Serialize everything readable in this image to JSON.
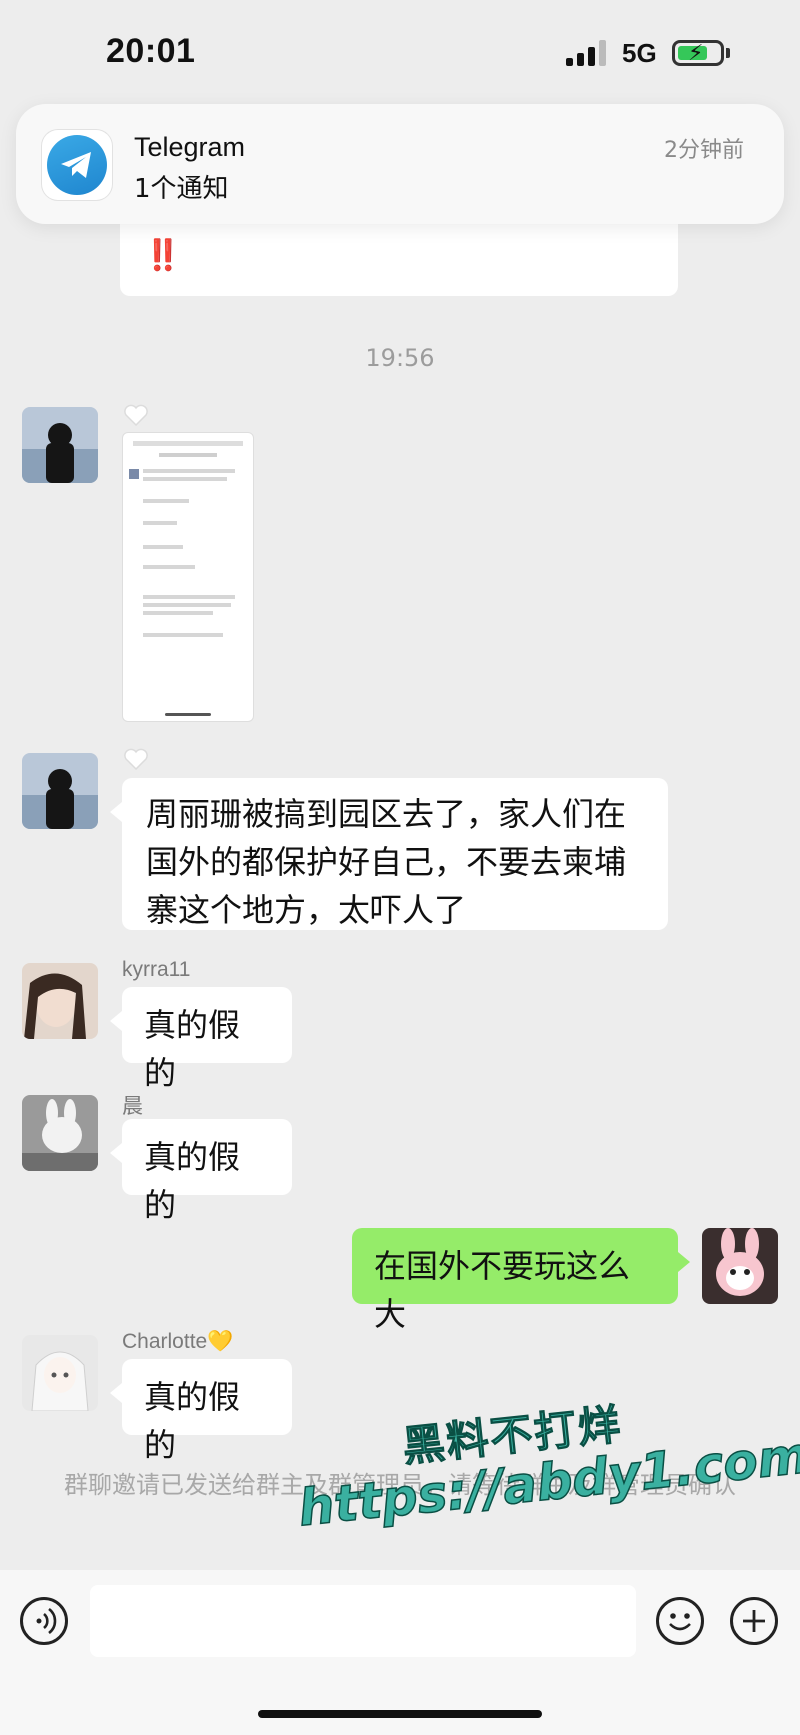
{
  "status_bar": {
    "time": "20:01",
    "network": "5G",
    "battery_level": 0.62
  },
  "notification": {
    "app_name": "Telegram",
    "message": "1个通知",
    "time": "2分钟前",
    "icon": "telegram-icon"
  },
  "chat": {
    "top_bubble_fragment": "‼️",
    "timestamp": "19:56",
    "messages": [
      {
        "type": "image",
        "side": "left",
        "sender": "",
        "content": "screenshot-thumbnail"
      },
      {
        "type": "text",
        "side": "left",
        "sender": "",
        "text": "周丽珊被搞到园区去了，家人们在国外的都保护好自己，不要去柬埔寨这个地方，太吓人了"
      },
      {
        "type": "text",
        "side": "left",
        "sender": "kyrra11",
        "text": "真的假的"
      },
      {
        "type": "text",
        "side": "left",
        "sender": "晨",
        "text": "真的假的"
      },
      {
        "type": "text",
        "side": "right",
        "sender": "",
        "text": "在国外不要玩这么大"
      },
      {
        "type": "text",
        "side": "left",
        "sender": "Charlotte💛",
        "text": "真的假的"
      }
    ],
    "system_message": "群聊邀请已发送给群主及群管理员，请等待群主及群管理员确认"
  },
  "watermark": {
    "line1": "黑料不打烊",
    "line2": "https://abdy1.com"
  },
  "input_bar": {
    "voice_icon": "voice-icon",
    "emoji_icon": "emoji-icon",
    "plus_icon": "plus-icon",
    "text": ""
  },
  "colors": {
    "background": "#ededed",
    "bubble_sent": "#95ec69",
    "bubble_received": "#ffffff",
    "telegram": "#2aa3e4"
  }
}
